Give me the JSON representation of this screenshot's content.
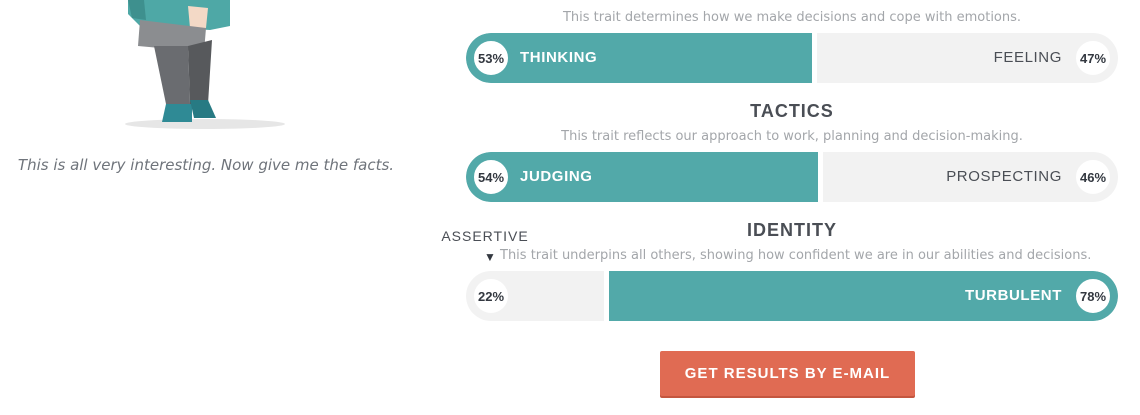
{
  "caption": "This is all very interesting. Now give me the facts.",
  "traits": [
    {
      "heading": "",
      "description": "This trait determines how we make decisions and cope with emotions.",
      "left": {
        "label": "THINKING",
        "percent": "53%"
      },
      "right": {
        "label": "FEELING",
        "percent": "47%"
      },
      "dominant": "left",
      "dominant_fraction": 0.53
    },
    {
      "heading": "TACTICS",
      "description": "This trait reflects our approach to work, planning and decision-making.",
      "left": {
        "label": "JUDGING",
        "percent": "54%"
      },
      "right": {
        "label": "PROSPECTING",
        "percent": "46%"
      },
      "dominant": "left",
      "dominant_fraction": 0.54
    },
    {
      "heading": "IDENTITY",
      "description": "This trait underpins all others, showing how confident we are in our abilities and decisions.",
      "left": {
        "label": "",
        "percent": "22%"
      },
      "right": {
        "label": "TURBULENT",
        "percent": "78%"
      },
      "dominant": "right",
      "dominant_fraction": 0.78
    }
  ],
  "marker": {
    "label": "ASSERTIVE",
    "arrow": "▼"
  },
  "cta": {
    "label": "GET RESULTS BY E-MAIL"
  },
  "colors": {
    "accent": "#52a9a9",
    "track": "#f2f2f2",
    "button": "#e06b53",
    "text": "#4a4e55",
    "muted": "#a3a6aa"
  }
}
